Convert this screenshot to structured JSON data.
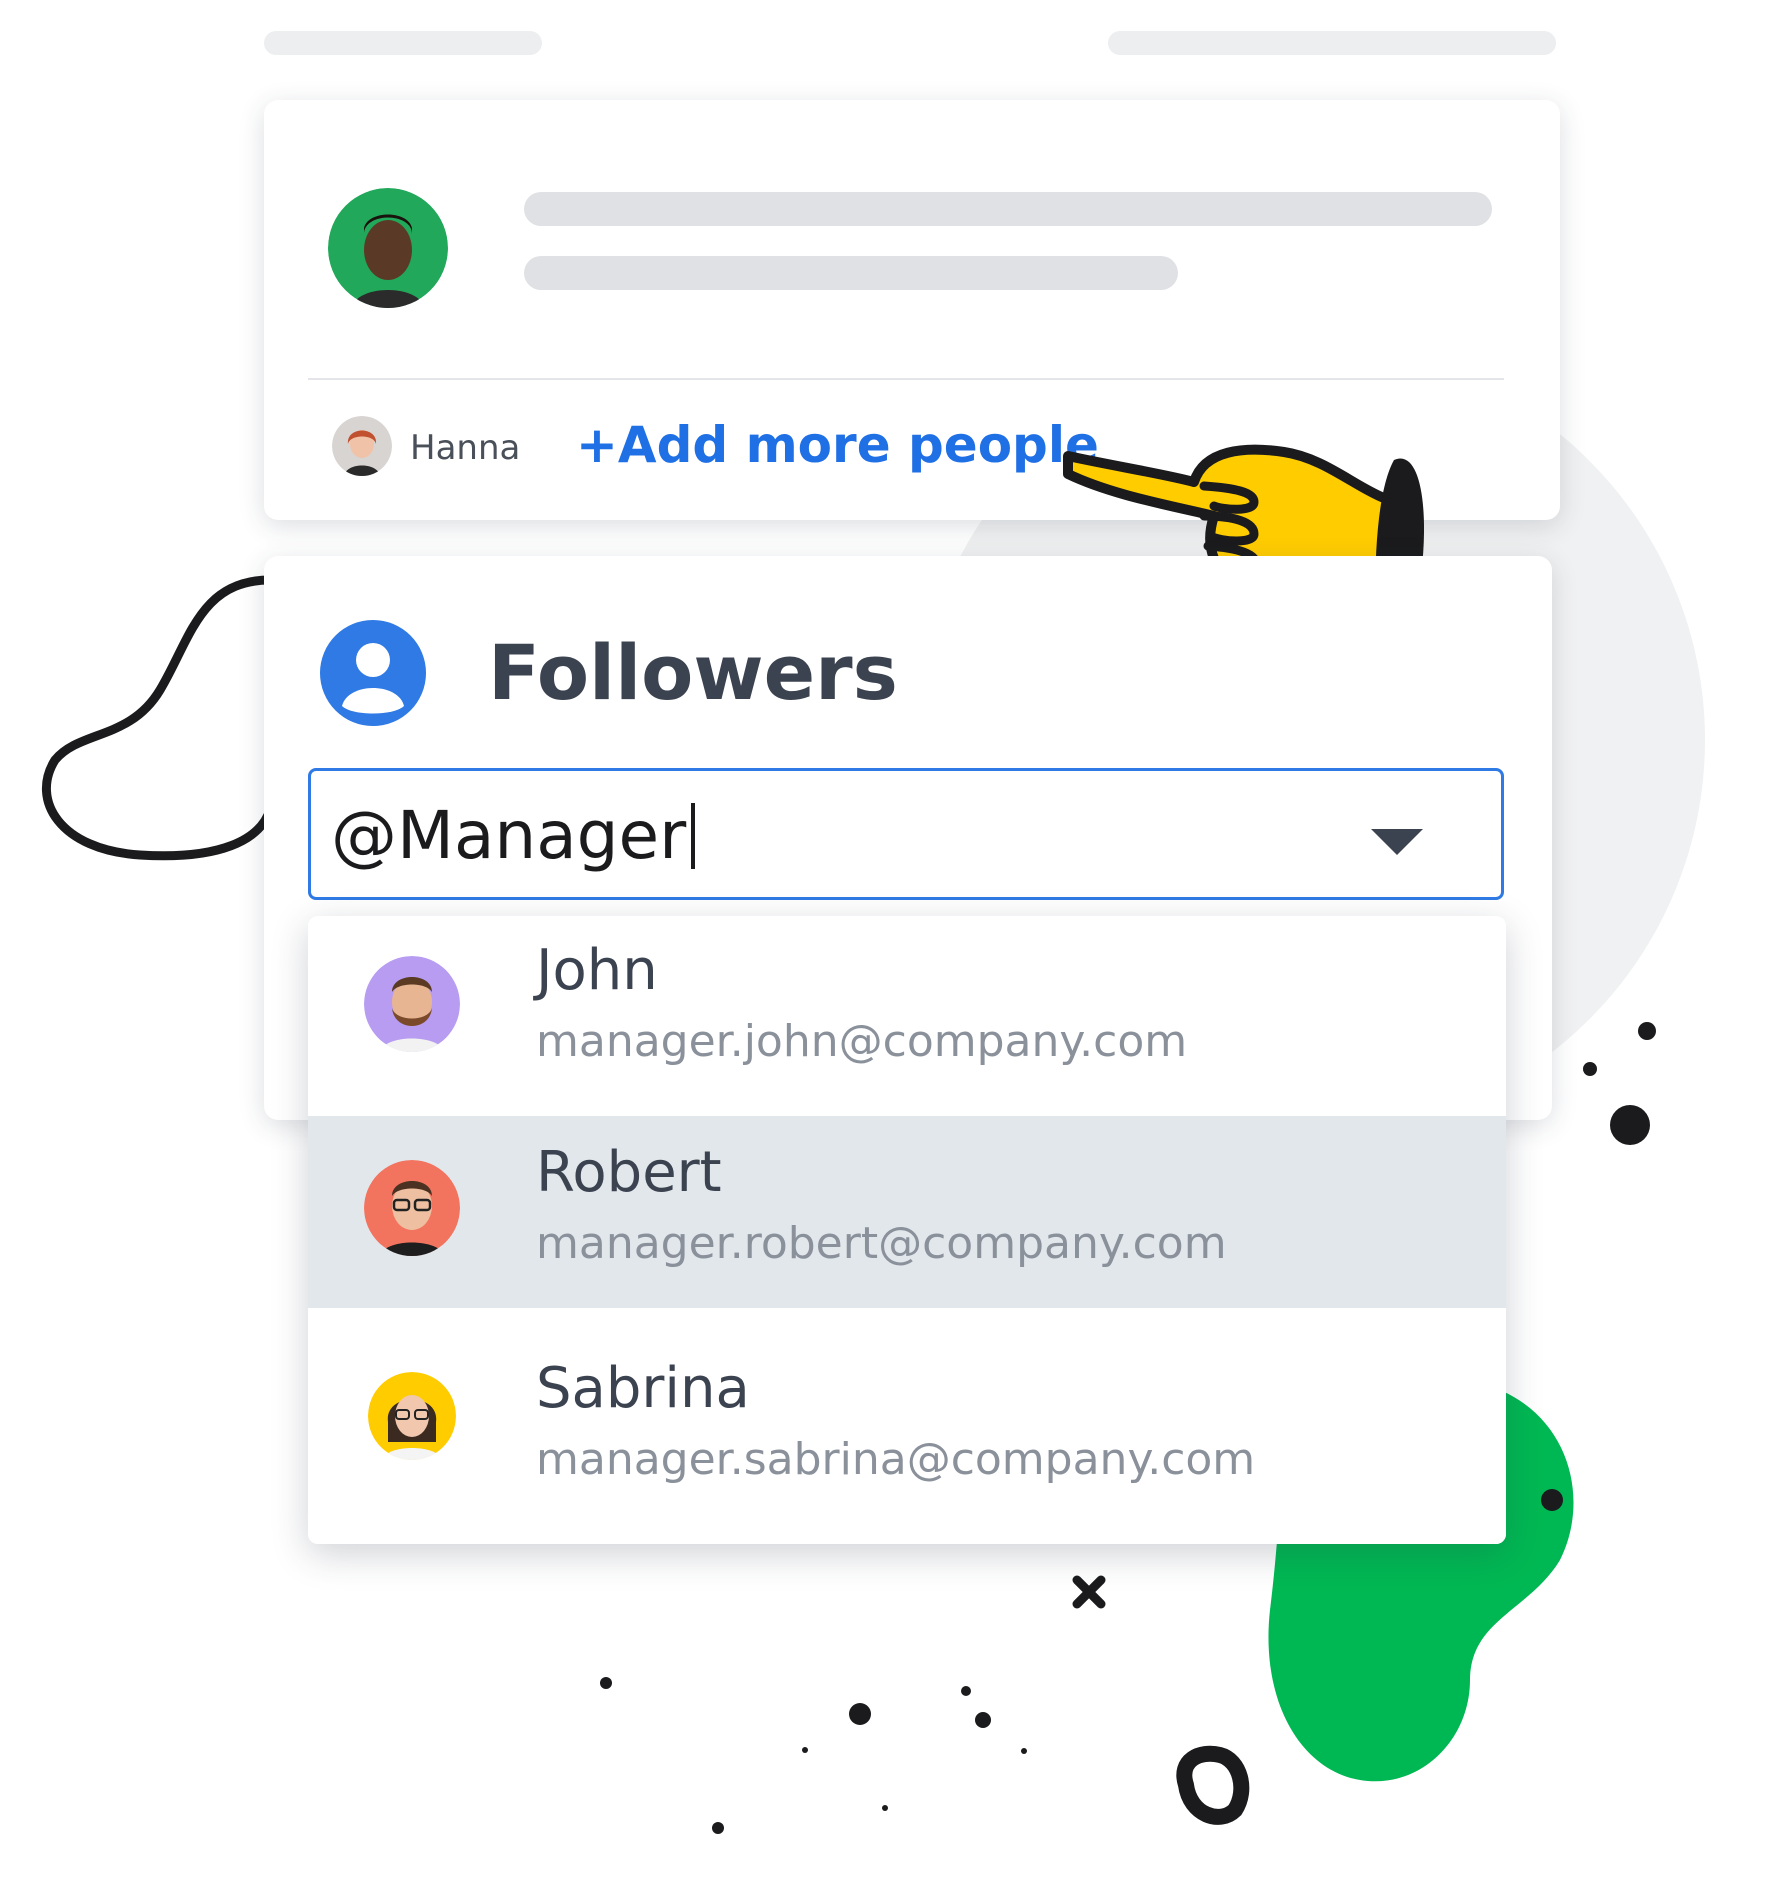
{
  "post_card": {
    "tagged_person": "Hanna",
    "add_link": "+Add more people"
  },
  "followers_panel": {
    "title": "Followers",
    "input_value": "@Manager"
  },
  "dropdown": {
    "items": [
      {
        "name": "John",
        "email": "manager.john@company.com",
        "avatar_color": "#b79cf2",
        "selected": false
      },
      {
        "name": "Robert",
        "email": "manager.robert@company.com",
        "avatar_color": "#f2745f",
        "selected": true
      },
      {
        "name": "Sabrina",
        "email": "manager.sabrina@company.com",
        "avatar_color": "#ffcc00",
        "selected": false
      }
    ]
  },
  "colors": {
    "accent_blue": "#1f6fe5",
    "selected_row": "#e2e7ec",
    "green_blob": "#00b853",
    "pointer_yellow": "#ffcc00"
  },
  "icons": [
    "user-circle-icon",
    "chevron-down-icon",
    "pointing-hand-icon"
  ]
}
